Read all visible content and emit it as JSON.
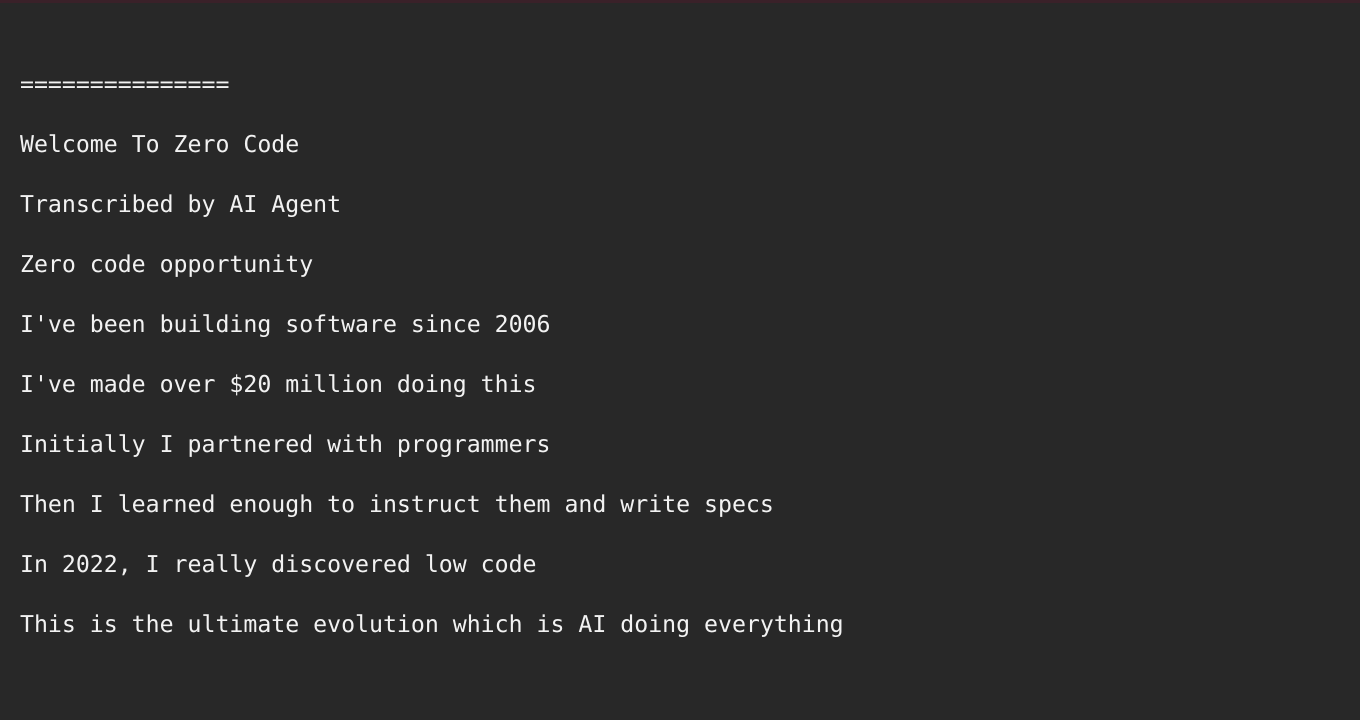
{
  "terminal": {
    "background_color": "#282828",
    "text_color": "#f2f2f2",
    "top_strip_color": "#3a2129",
    "lines": [
      {
        "id": "divider",
        "text": "==============="
      },
      {
        "id": "title",
        "text": "Welcome To Zero Code"
      },
      {
        "id": "byline",
        "text": "Transcribed by AI Agent"
      },
      {
        "id": "topic",
        "text": "Zero code opportunity"
      },
      {
        "id": "experience",
        "text": "I've been building software since 2006"
      },
      {
        "id": "earnings",
        "text": "I've made over $20 million doing this"
      },
      {
        "id": "partners",
        "text": "Initially I partnered with programmers"
      },
      {
        "id": "specs",
        "text": "Then I learned enough to instruct them and write specs"
      },
      {
        "id": "lowcode",
        "text": "In 2022, I really discovered low code"
      },
      {
        "id": "ultimate",
        "text": "This is the ultimate evolution which is AI doing everything"
      }
    ]
  }
}
